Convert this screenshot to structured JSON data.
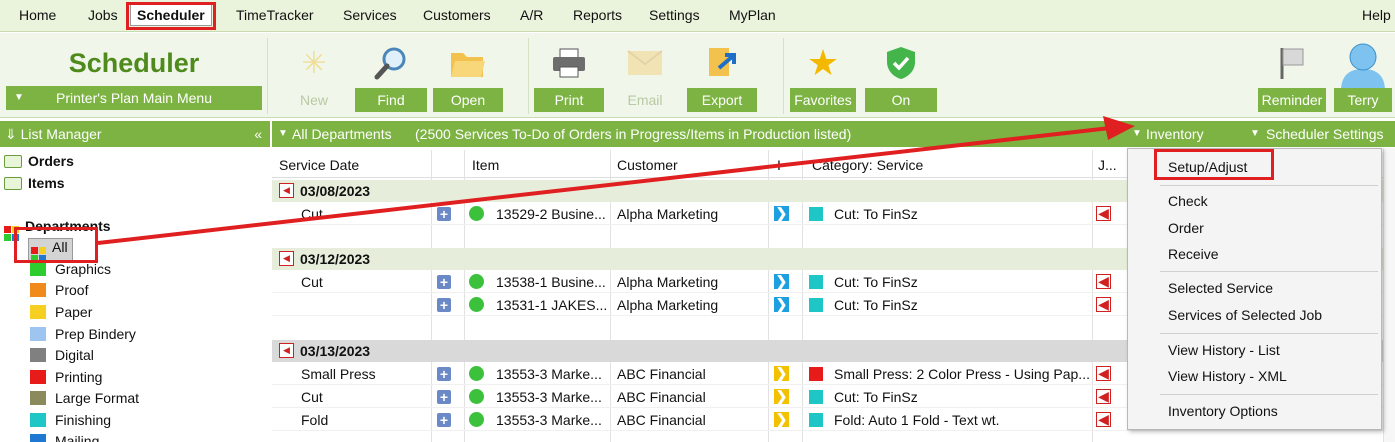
{
  "menu": {
    "items": [
      "Home",
      "Jobs",
      "Scheduler",
      "TimeTracker",
      "Services",
      "Customers",
      "A/R",
      "Reports",
      "Settings",
      "MyPlan"
    ],
    "help": "Help"
  },
  "ribbon": {
    "title": "Scheduler",
    "main_menu": "Printer's Plan Main Menu",
    "buttons": {
      "new": "New",
      "find": "Find",
      "open": "Open",
      "print": "Print",
      "email": "Email",
      "export": "Export",
      "favorites": "Favorites",
      "on": "On",
      "reminder": "Reminder",
      "user": "Terry"
    }
  },
  "list_manager": {
    "title": "List Manager",
    "collapse": "«"
  },
  "dept_bar": {
    "departments": "All Departments",
    "summary": "(2500 Services To-Do of Orders in Progress/Items in Production listed)",
    "inventory": "Inventory",
    "scheduler_settings": "Scheduler Settings"
  },
  "tree": {
    "orders": "Orders",
    "items": "Items",
    "departments": "Departments",
    "all": "All",
    "depts": [
      {
        "label": "Graphics",
        "color": "#2ecc2e"
      },
      {
        "label": "Proof",
        "color": "#f08a1c"
      },
      {
        "label": "Paper",
        "color": "#f5d020"
      },
      {
        "label": "Prep Bindery",
        "color": "#9ec5f0"
      },
      {
        "label": "Digital",
        "color": "#808080"
      },
      {
        "label": "Printing",
        "color": "#e81b1b"
      },
      {
        "label": "Large Format",
        "color": "#8a8a5c"
      },
      {
        "label": "Finishing",
        "color": "#1fc6c6"
      },
      {
        "label": "Mailing",
        "color": "#1f78d1"
      }
    ]
  },
  "columns": {
    "service_date": "Service Date",
    "item": "Item",
    "customer": "Customer",
    "i": "I",
    "category": "Category: Service",
    "j": "J..."
  },
  "groups": [
    {
      "date": "03/08/2023",
      "rows": [
        {
          "service": "Cut",
          "item": "13529-2 Busine...",
          "customer": "Alpha Marketing",
          "arrow": "blue",
          "cat_color": "#1fc6c6",
          "category": "Cut: To FinSz"
        }
      ]
    },
    {
      "date": "03/12/2023",
      "rows": [
        {
          "service": "Cut",
          "item": "13538-1 Busine...",
          "customer": "Alpha Marketing",
          "arrow": "blue",
          "cat_color": "#1fc6c6",
          "category": "Cut: To FinSz"
        },
        {
          "service": "",
          "item": "13531-1 JAKES...",
          "customer": "Alpha Marketing",
          "arrow": "blue",
          "cat_color": "#1fc6c6",
          "category": "Cut: To FinSz"
        }
      ]
    },
    {
      "date": "03/13/2023",
      "rows": [
        {
          "service": "Small Press",
          "item": "13553-3 Marke...",
          "customer": "ABC Financial",
          "arrow": "yellow",
          "cat_color": "#e81b1b",
          "category": "Small Press: 2 Color Press - Using Pap..."
        },
        {
          "service": "Cut",
          "item": "13553-3 Marke...",
          "customer": "ABC Financial",
          "arrow": "yellow",
          "cat_color": "#1fc6c6",
          "category": "Cut: To FinSz"
        },
        {
          "service": "Fold",
          "item": "13553-3 Marke...",
          "customer": "ABC Financial",
          "arrow": "yellow",
          "cat_color": "#1fc6c6",
          "category": "Fold: Auto 1 Fold - Text wt."
        }
      ]
    }
  ],
  "context_menu": {
    "setup": "Setup/Adjust",
    "check": "Check",
    "order": "Order",
    "receive": "Receive",
    "selected_service": "Selected Service",
    "services_selected_job": "Services of Selected Job",
    "history_list": "View History - List",
    "history_xml": "View History - XML",
    "options": "Inventory Options"
  },
  "colors": {
    "accent": "#7cb342",
    "highlight": "#e02020"
  }
}
